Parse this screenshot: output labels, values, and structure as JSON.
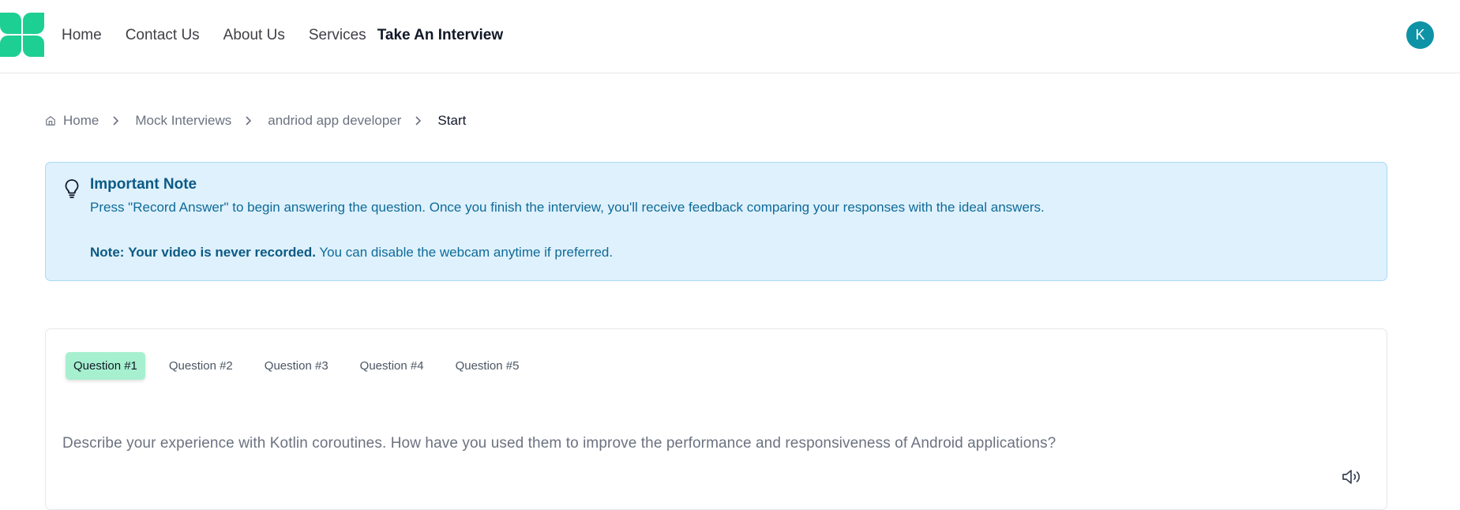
{
  "nav": {
    "links": [
      "Home",
      "Contact Us",
      "About Us",
      "Services",
      "Take An Interview"
    ],
    "avatar_initial": "K"
  },
  "breadcrumb": [
    "Home",
    "Mock Interviews",
    "andriod app developer",
    "Start"
  ],
  "note": {
    "title": "Important Note",
    "text": "Press \"Record Answer\" to begin answering the question. Once you finish the interview, you'll receive feedback comparing your responses with the ideal answers.",
    "note_label": "Note:",
    "note_strong": "Your video is never recorded.",
    "note_rest": "You can disable the webcam anytime if preferred."
  },
  "tabs": [
    "Question #1",
    "Question #2",
    "Question #3",
    "Question #4",
    "Question #5"
  ],
  "active_tab": 0,
  "question_text": "Describe your experience with Kotlin coroutines. How have you used them to improve the performance and responsiveness of Android applications?",
  "colors": {
    "brand": "#1ecf93",
    "avatar": "#0e93a6",
    "note_bg": "#dff1fc",
    "tab_active": "#a6f0cf"
  }
}
